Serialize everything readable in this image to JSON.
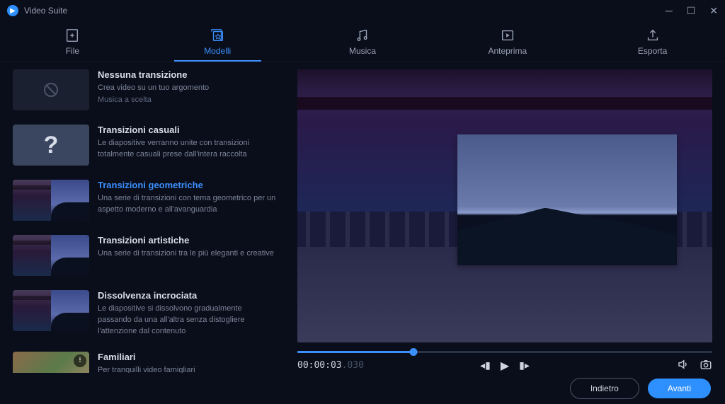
{
  "app": {
    "title": "Video Suite"
  },
  "tabs": [
    {
      "label": "File"
    },
    {
      "label": "Modelli"
    },
    {
      "label": "Musica"
    },
    {
      "label": "Anteprima"
    },
    {
      "label": "Esporta"
    }
  ],
  "templates": [
    {
      "title": "Nessuna transizione",
      "desc": "Crea video su un tuo argomento",
      "extra": "Musica a scelta"
    },
    {
      "title": "Transizioni casuali",
      "desc": "Le diapositive verranno unite con transizioni totalmente casuali prese dall'intera raccolta"
    },
    {
      "title": "Transizioni geometriche",
      "desc": "Una serie di transizioni con tema geometrico per un aspetto moderno e all'avanguardia"
    },
    {
      "title": "Transizioni artistiche",
      "desc": "Una serie di transizioni tra le più eleganti e creative"
    },
    {
      "title": "Dissolvenza incrociata",
      "desc": "Le diapositive si dissolvono gradualmente passando da una all'altra senza distogliere l'attenzione dal contenuto"
    },
    {
      "title": "Familiari",
      "desc": "Per tranquilli video famigliari"
    }
  ],
  "playback": {
    "time_main": "00:00:03",
    "time_frac": ".030"
  },
  "buttons": {
    "back": "Indietro",
    "next": "Avanti"
  }
}
